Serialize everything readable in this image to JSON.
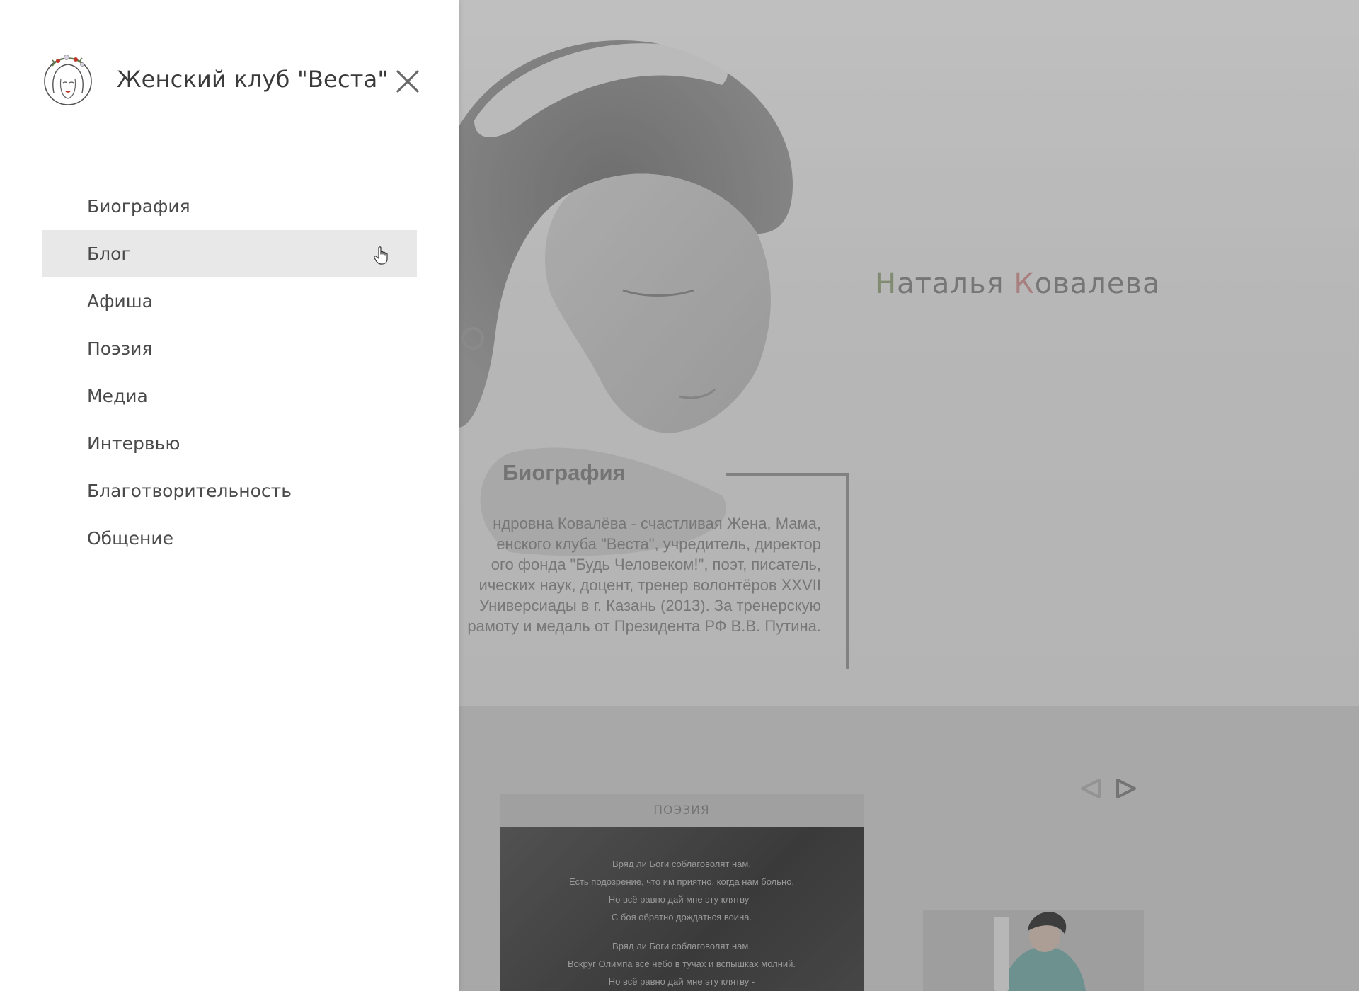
{
  "drawer": {
    "title": "Женский клуб \"Веста\"",
    "nav_items": [
      {
        "label": "Биография"
      },
      {
        "label": "Блог"
      },
      {
        "label": "Афиша"
      },
      {
        "label": "Поэзия"
      },
      {
        "label": "Медиа"
      },
      {
        "label": "Интервью"
      },
      {
        "label": "Благотворительность"
      },
      {
        "label": "Общение"
      }
    ],
    "active_item": "Блог",
    "close_icon": "close-icon",
    "logo_icon": "vesta-logo"
  },
  "hero": {
    "name_first_initial": "Н",
    "name_first_rest": "аталья ",
    "name_last_initial": "К",
    "name_last_rest": "овалева",
    "bio_title": "Биография",
    "bio_lines": [
      "ндровна Ковалёва - счастливая Жена, Мама,",
      "енского клуба \"Веста\", учредитель, директор",
      "ого фонда \"Будь Человеком!\", поэт, писатель,",
      "ических наук, доцент, тренер волонтёров XXVII",
      "Универсиады в г. Казань (2013). За тренерскую",
      "рамоту и медаль от Президента РФ В.В. Путина."
    ]
  },
  "poetry": {
    "header": "ПОЭЗИЯ",
    "stanza1": [
      "Вряд ли Боги соблаговолят нам.",
      "Есть подозрение, что им приятно, когда нам больно.",
      "Но всё равно дай мне эту клятву -",
      "С боя обратно дождаться воина."
    ],
    "stanza2": [
      "Вряд ли Боги соблаговолят нам.",
      "Вокруг Олимпа всё небо в тучах и вспышках молний.",
      "Но всё равно дай мне эту клятву -"
    ]
  },
  "carousel": {
    "prev_icon": "triangle-left-icon",
    "next_icon": "triangle-right-icon"
  },
  "colors": {
    "accent_green": "#9aa985",
    "accent_red": "#d39a9a",
    "drawer_bg": "#ffffff",
    "active_item_bg": "#e8e8e8"
  }
}
